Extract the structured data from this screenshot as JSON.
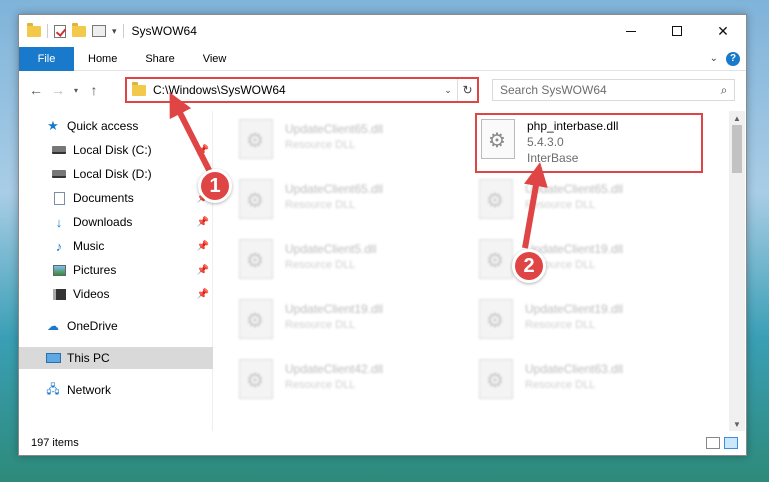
{
  "window": {
    "title": "SysWOW64"
  },
  "ribbon": {
    "file": "File",
    "home": "Home",
    "share": "Share",
    "view": "View"
  },
  "address": {
    "path": "C:\\Windows\\SysWOW64",
    "search_placeholder": "Search SysWOW64"
  },
  "sidebar": {
    "items": [
      {
        "label": "Quick access",
        "icon": "star-icon"
      },
      {
        "label": "Local Disk (C:)",
        "icon": "disk-icon"
      },
      {
        "label": "Local Disk (D:)",
        "icon": "disk-icon"
      },
      {
        "label": "Documents",
        "icon": "document-icon"
      },
      {
        "label": "Downloads",
        "icon": "download-icon"
      },
      {
        "label": "Music",
        "icon": "music-icon"
      },
      {
        "label": "Pictures",
        "icon": "pictures-icon"
      },
      {
        "label": "Videos",
        "icon": "videos-icon"
      },
      {
        "label": "OneDrive",
        "icon": "cloud-icon"
      },
      {
        "label": "This PC",
        "icon": "computer-icon"
      },
      {
        "label": "Network",
        "icon": "network-icon"
      }
    ]
  },
  "files": [
    {
      "name": "UpdateClient65.dll",
      "type": "Resource DLL"
    },
    {
      "name": "php_interbase.dll",
      "version": "5.4.3.0",
      "type": "InterBase"
    },
    {
      "name": "UpdateClient65.dll",
      "type": "Resource DLL"
    },
    {
      "name": "UpdateClient65.dll",
      "type": "Resource DLL"
    },
    {
      "name": "UpdateClient5.dll",
      "type": "Resource DLL"
    },
    {
      "name": "UpdateClient19.dll",
      "type": "Resource DLL"
    },
    {
      "name": "UpdateClient19.dll",
      "type": "Resource DLL"
    },
    {
      "name": "UpdateClient19.dll",
      "type": "Resource DLL"
    },
    {
      "name": "UpdateClient42.dll",
      "type": "Resource DLL"
    },
    {
      "name": "UpdateClient63.dll",
      "type": "Resource DLL"
    }
  ],
  "status": {
    "item_count": "197 items"
  },
  "annotations": {
    "step1": "1",
    "step2": "2",
    "color": "#e04545"
  }
}
